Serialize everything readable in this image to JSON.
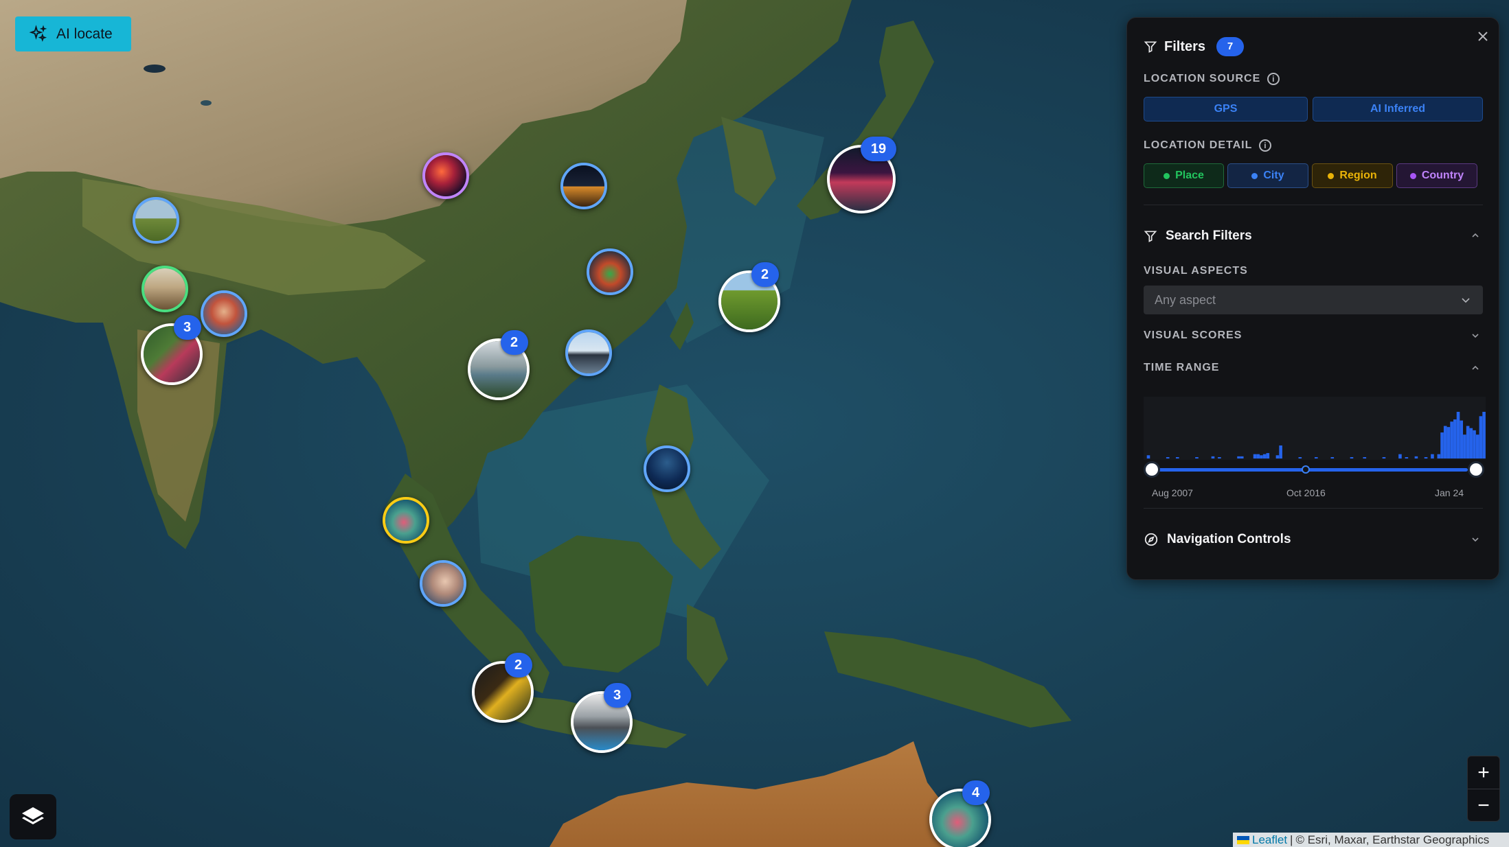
{
  "ai_locate": {
    "label": "AI locate"
  },
  "filters": {
    "title": "Filters",
    "count": "7",
    "location_source": {
      "label": "LOCATION SOURCE",
      "options": [
        "GPS",
        "AI Inferred"
      ]
    },
    "location_detail": {
      "label": "LOCATION DETAIL",
      "options": [
        {
          "label": "Place",
          "color": "#22c55e"
        },
        {
          "label": "City",
          "color": "#3b82f6"
        },
        {
          "label": "Region",
          "color": "#eab308"
        },
        {
          "label": "Country",
          "color": "#a855f7"
        }
      ]
    },
    "search_filters": {
      "title": "Search Filters",
      "visual_aspects": {
        "label": "VISUAL ASPECTS",
        "placeholder": "Any aspect"
      },
      "visual_scores": {
        "label": "VISUAL SCORES"
      },
      "time_range": {
        "label": "TIME RANGE",
        "start_label": "Aug 2007",
        "mid_label": "Oct 2016",
        "end_label": "Jan 24",
        "selection": [
          0,
          1
        ],
        "histogram": [
          0,
          3,
          0,
          0,
          0,
          0,
          0,
          1,
          0,
          0,
          1,
          0,
          0,
          0,
          0,
          0,
          1,
          0,
          0,
          0,
          0,
          2,
          0,
          1,
          0,
          0,
          0,
          0,
          0,
          2,
          2,
          0,
          0,
          0,
          4,
          4,
          3,
          4,
          5,
          0,
          0,
          3,
          12,
          0,
          0,
          0,
          0,
          0,
          1,
          0,
          0,
          0,
          0,
          1,
          0,
          0,
          0,
          0,
          1,
          0,
          0,
          0,
          0,
          0,
          1,
          0,
          0,
          0,
          1,
          0,
          0,
          0,
          0,
          0,
          1,
          0,
          0,
          0,
          0,
          4,
          0,
          1,
          0,
          0,
          2,
          0,
          0,
          1,
          0,
          4,
          0,
          4,
          24,
          30,
          29,
          34,
          36,
          43,
          35,
          22,
          30,
          28,
          26,
          22,
          39,
          43
        ]
      }
    },
    "navigation_controls": {
      "title": "Navigation Controls"
    }
  },
  "markers": [
    {
      "id": "himalaya-west",
      "count": null,
      "ring": "#60a5fa",
      "scene": "hills"
    },
    {
      "id": "north-china",
      "count": null,
      "ring": "#c084fc",
      "scene": "lights"
    },
    {
      "id": "beijing",
      "count": null,
      "ring": "#60a5fa",
      "scene": "night"
    },
    {
      "id": "japan",
      "count": "19",
      "ring": "#ffffff",
      "scene": "city"
    },
    {
      "id": "india-north",
      "count": null,
      "ring": "#4ade80",
      "scene": "architecture"
    },
    {
      "id": "nepal",
      "count": null,
      "ring": "#60a5fa",
      "scene": "portrait"
    },
    {
      "id": "india",
      "count": "3",
      "ring": "#ffffff",
      "scene": "street"
    },
    {
      "id": "east-china",
      "count": null,
      "ring": "#60a5fa",
      "scene": "market"
    },
    {
      "id": "taiwan",
      "count": "2",
      "ring": "#ffffff",
      "scene": "forest"
    },
    {
      "id": "vietnam",
      "count": "2",
      "ring": "#ffffff",
      "scene": "river"
    },
    {
      "id": "hong-kong",
      "count": null,
      "ring": "#60a5fa",
      "scene": "harbor"
    },
    {
      "id": "philippines",
      "count": null,
      "ring": "#60a5fa",
      "scene": "underwater"
    },
    {
      "id": "thailand",
      "count": null,
      "ring": "#facc15",
      "scene": "reef"
    },
    {
      "id": "malaysia",
      "count": null,
      "ring": "#60a5fa",
      "scene": "coral"
    },
    {
      "id": "sumatra",
      "count": "2",
      "ring": "#ffffff",
      "scene": "dark"
    },
    {
      "id": "java",
      "count": "3",
      "ring": "#ffffff",
      "scene": "temple"
    },
    {
      "id": "australia",
      "count": "4",
      "ring": "#ffffff",
      "scene": "reef"
    }
  ],
  "zoom": {
    "in": "+",
    "out": "−"
  },
  "attribution": {
    "leaflet": "Leaflet",
    "sep": "|",
    "credits": "© Esri, Maxar, Earthstar Geographics"
  }
}
